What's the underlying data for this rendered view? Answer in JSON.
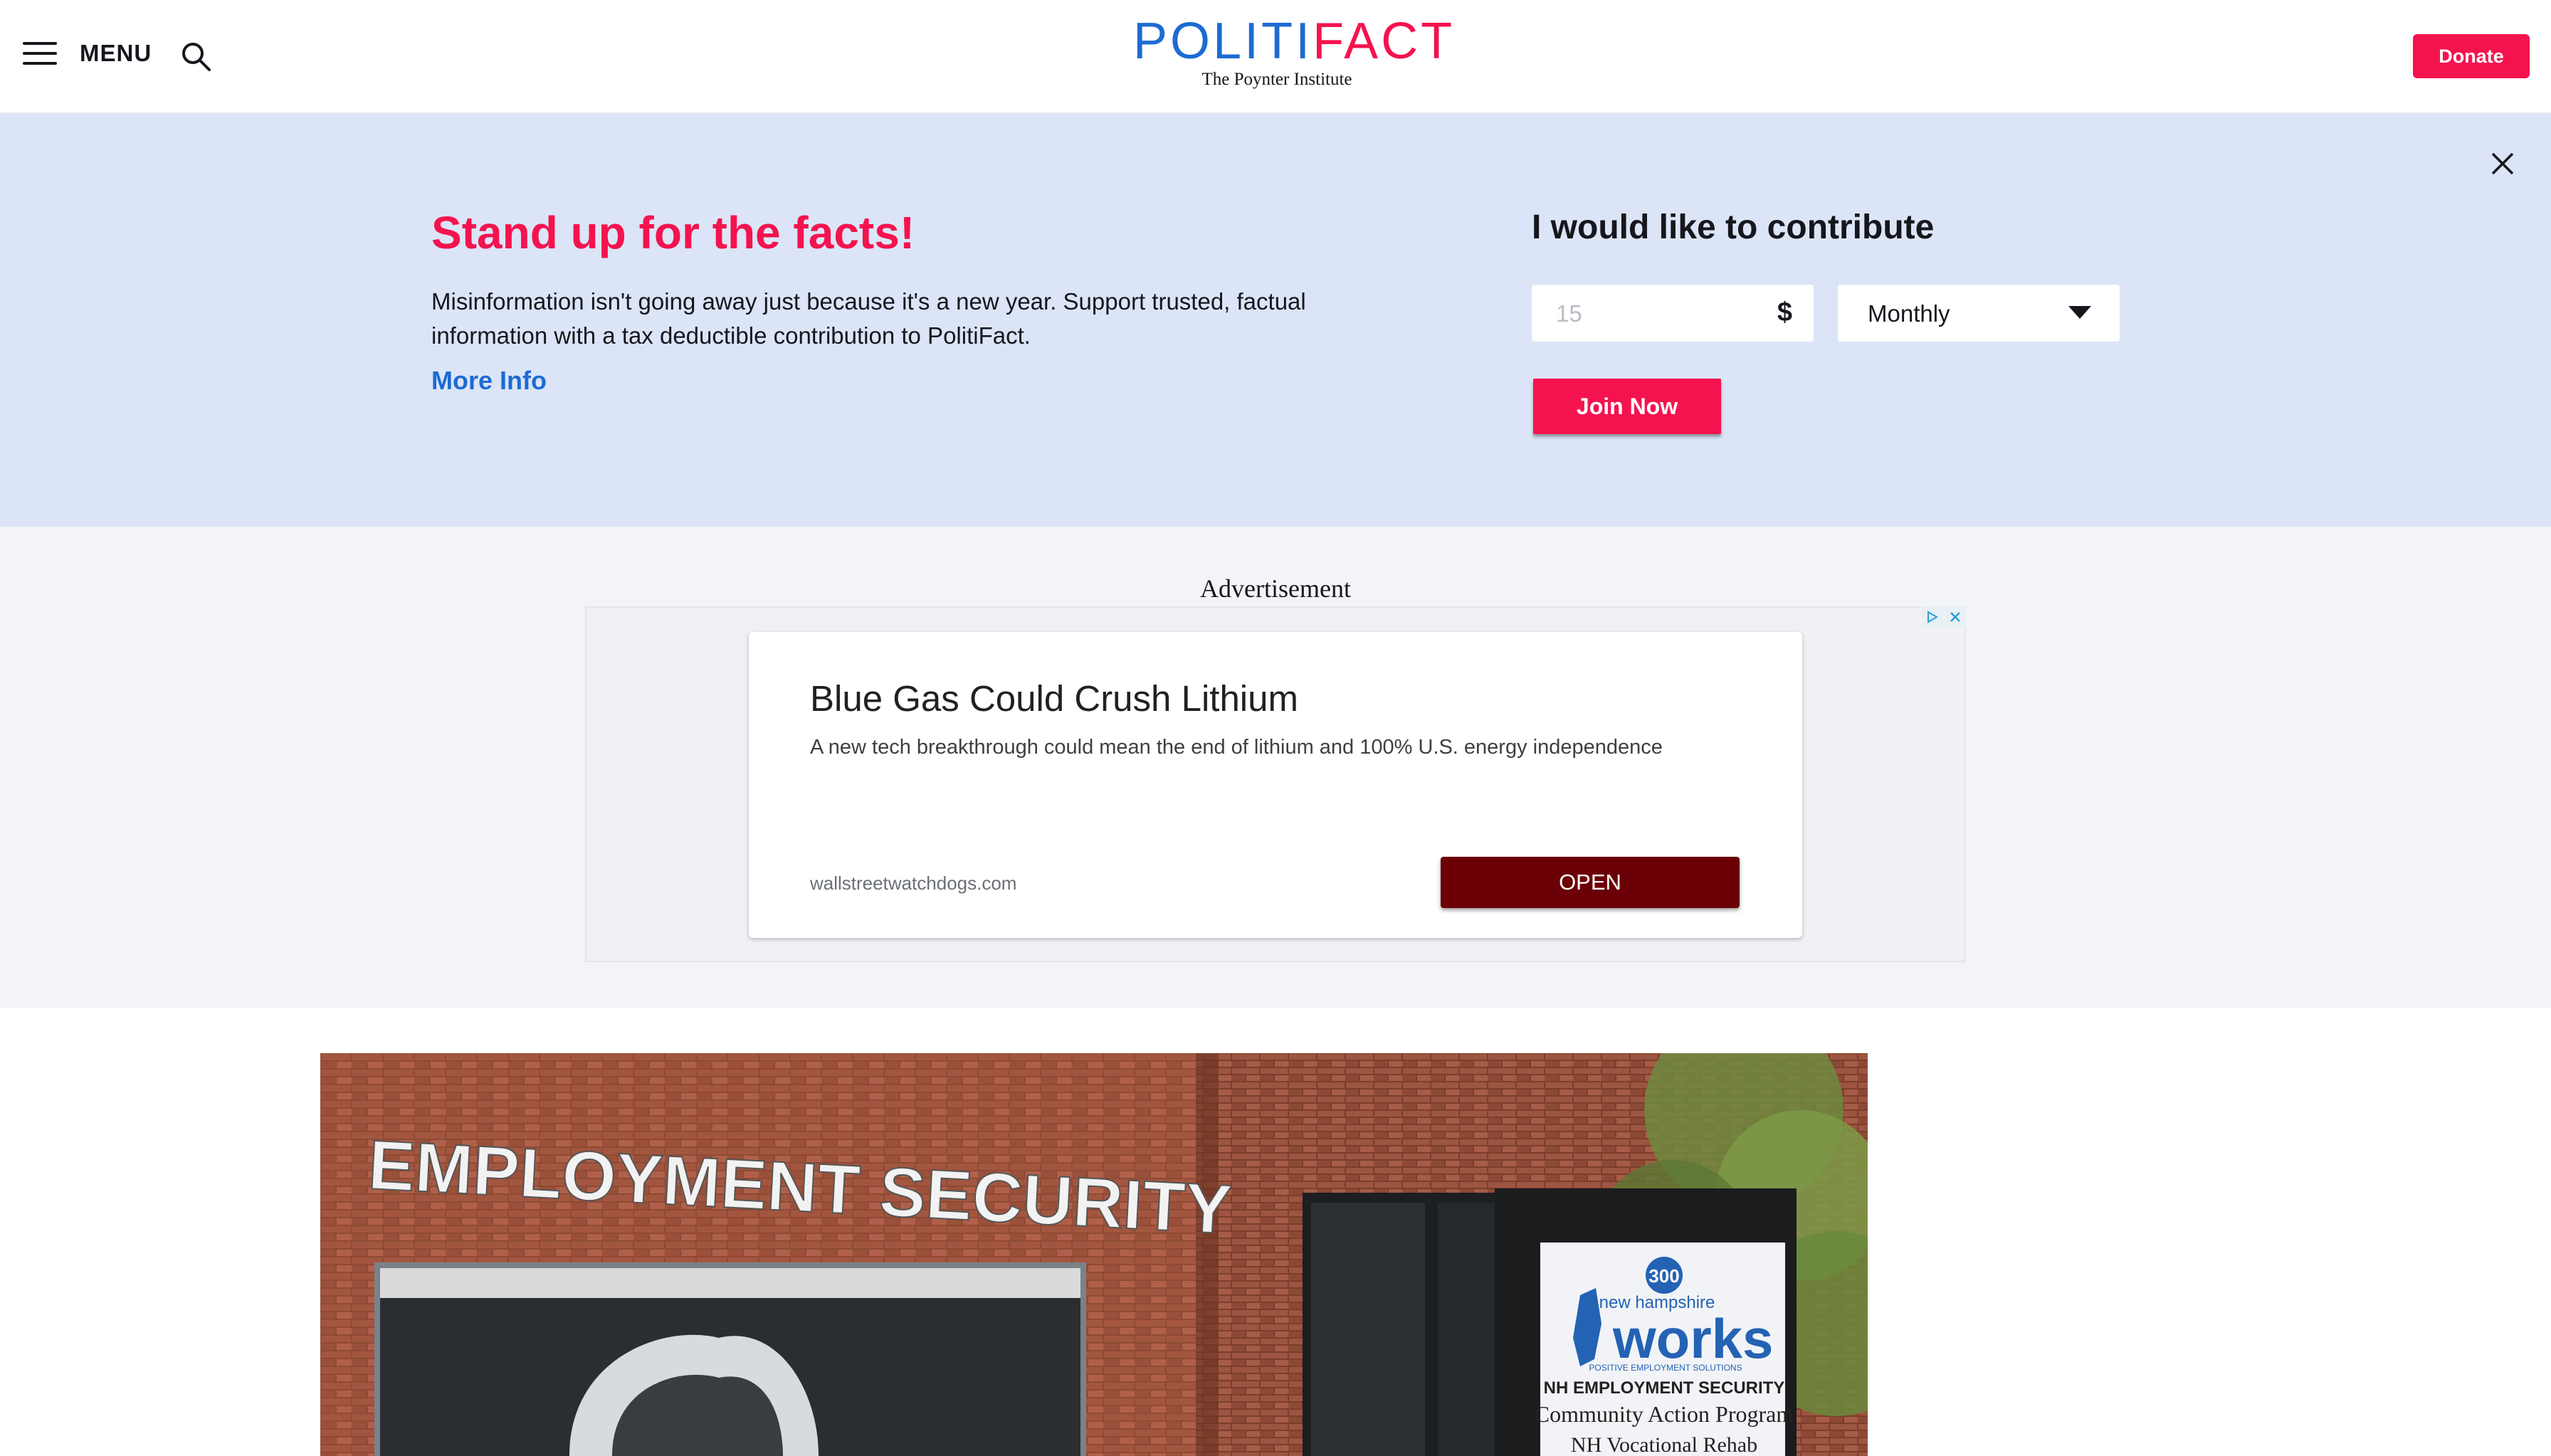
{
  "header": {
    "menu_label": "MENU",
    "logo": {
      "word_part1": "P",
      "word_part2": "O",
      "word_part3": "LITI",
      "word_part4": "FACT",
      "subtitle": "The Poynter Institute"
    },
    "donate_label": "Donate",
    "icons": [
      "hamburger-icon",
      "search-icon"
    ]
  },
  "banner": {
    "title": "Stand up for the facts!",
    "text": "Misinformation isn't going away just because it's a new year. Support trusted, factual information with a tax deductible contribution to PolitiFact.",
    "more_info": "More Info",
    "contribute_title": "I would like to contribute",
    "amount_placeholder": "15",
    "currency_symbol": "$",
    "frequency": "Monthly",
    "join_label": "Join Now",
    "close_icon": "close-icon"
  },
  "ad": {
    "label": "Advertisement",
    "headline": "Blue Gas Could Crush Lithium",
    "body": "A new tech breakthrough could mean the end of lithium and 100% U.S. energy independence",
    "domain": "wallstreetwatchdogs.com",
    "cta": "OPEN"
  },
  "article_image": {
    "sign_text": "EMPLOYMENT SECURITY",
    "placard": {
      "number": "300",
      "state": "new hampshire",
      "brand": "works",
      "tagline": "POSITIVE EMPLOYMENT SOLUTIONS",
      "line1": "NH EMPLOYMENT SECURITY",
      "line2": "Community Action Program",
      "line3": "NH Vocational Rehab"
    }
  },
  "colors": {
    "brand_red": "#f4134e",
    "brand_blue": "#1d6bd3",
    "banner_bg": "#dbe5f7",
    "ad_button": "#6b0006"
  }
}
